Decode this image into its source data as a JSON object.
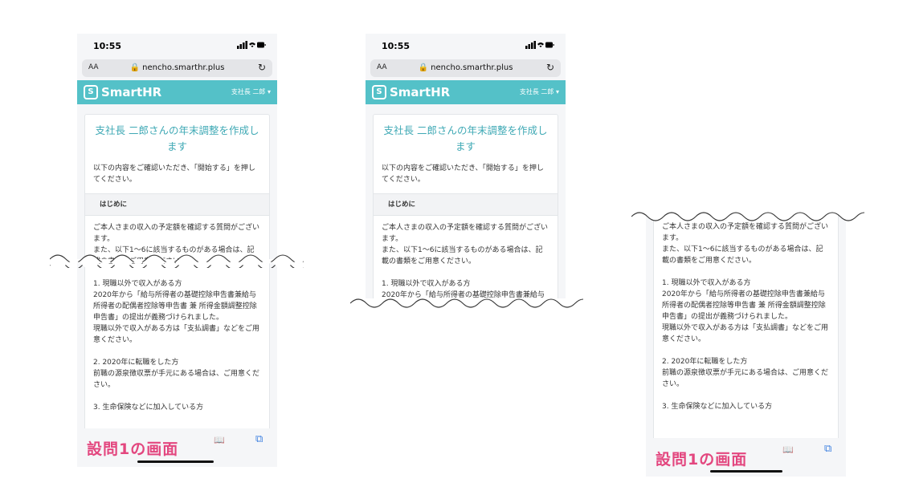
{
  "status": {
    "time": "10:55"
  },
  "browser": {
    "aa_label": "AA",
    "url": "nencho.smarthr.plus",
    "reload_icon": "reload-icon"
  },
  "app": {
    "logo": "SmartHR",
    "user_menu": "支社長 二郎 ▾"
  },
  "card": {
    "title": "支社長 二郎さんの年末調整を作成します",
    "intro": "以下の内容をご確認いただき、「開始する」を押してください。",
    "section_label": "はじめに",
    "p1": "ご本人さまの収入の予定額を確認する質問がございます。",
    "p2": "また、以下1〜6に該当するものがある場合は、記載の書類をご用意ください。",
    "item1_head": "1. 現職以外で収入がある方",
    "item1_body": "2020年から「給与所得者の基礎控除申告書兼給与所得者の配偶者控除等申告書 兼 所得金額調整控除申告書」の提出が義務づけられました。",
    "item1_body2": "現職以外で収入がある方は「支払調書」などをご用意ください。",
    "item2_head": "2. 2020年に転職をした方",
    "item2_body": "前職の源泉徴収票が手元にある場合は、ご用意ください。",
    "item3_head": "3. 生命保険などに加入している方"
  },
  "caption": "設問1の画面",
  "colors": {
    "brand": "#54c1c8",
    "title": "#3fa9b5",
    "caption": "#e3477f"
  }
}
